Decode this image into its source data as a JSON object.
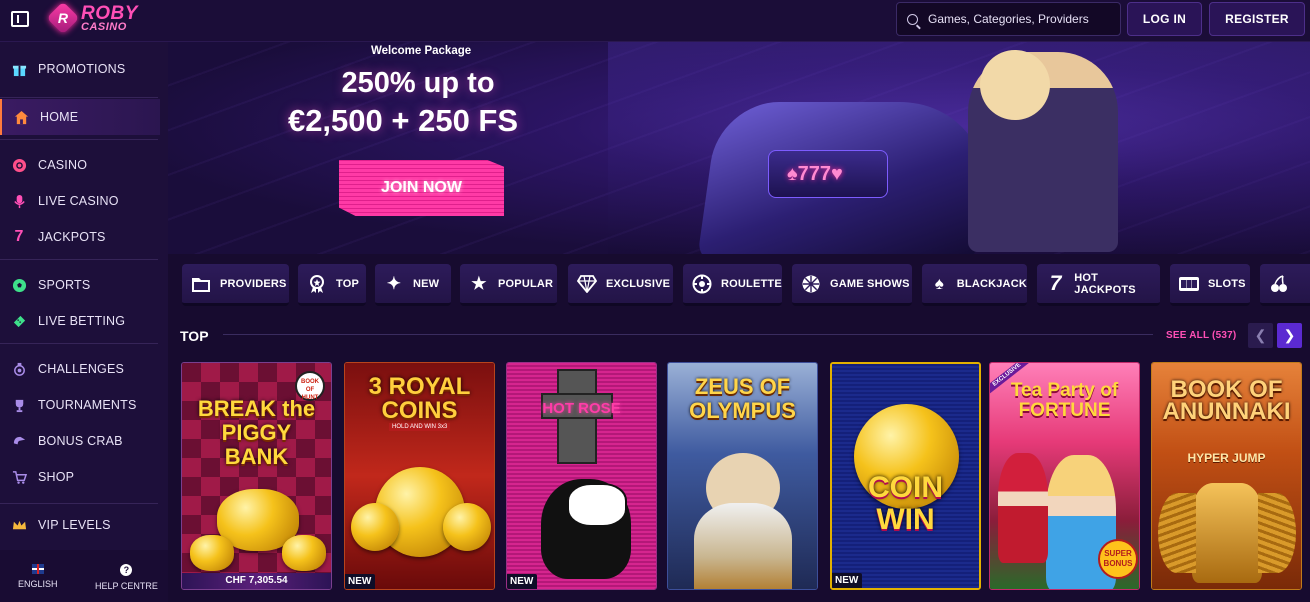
{
  "header": {
    "logo_text": "ROBY",
    "logo_sub": "CASINO",
    "search_placeholder": "Games, Categories, Providers",
    "login_label": "LOG IN",
    "register_label": "REGISTER"
  },
  "sidebar": {
    "items": [
      {
        "label": "PROMOTIONS",
        "icon": "gift-icon"
      },
      {
        "label": "HOME",
        "icon": "home-icon",
        "active": true
      },
      {
        "label": "CASINO",
        "icon": "chip-icon"
      },
      {
        "label": "LIVE CASINO",
        "icon": "microphone-icon"
      },
      {
        "label": "JACKPOTS",
        "icon": "seven-icon"
      },
      {
        "label": "SPORTS",
        "icon": "soccer-ball-icon"
      },
      {
        "label": "LIVE BETTING",
        "icon": "ticket-icon"
      },
      {
        "label": "CHALLENGES",
        "icon": "medal-icon"
      },
      {
        "label": "TOURNAMENTS",
        "icon": "trophy-icon"
      },
      {
        "label": "BONUS CRAB",
        "icon": "crab-claw-icon"
      },
      {
        "label": "SHOP",
        "icon": "cart-icon"
      },
      {
        "label": "VIP LEVELS",
        "icon": "crown-icon"
      }
    ],
    "footer": {
      "language_label": "ENGLISH",
      "help_label": "HELP CENTRE"
    }
  },
  "hero": {
    "kicker": "Welcome Package",
    "title_line1": "250% up to",
    "title_line2": "€2,500 + 250 FS",
    "cta_label": "JOIN NOW",
    "bike_text": "♠777♥"
  },
  "categories": [
    {
      "label": "PROVIDERS",
      "icon": "folder-icon"
    },
    {
      "label": "TOP",
      "icon": "award-icon"
    },
    {
      "label": "NEW",
      "icon": "sparkle-icon"
    },
    {
      "label": "POPULAR",
      "icon": "star-icon"
    },
    {
      "label": "EXCLUSIVE",
      "icon": "diamond-icon"
    },
    {
      "label": "ROULETTE",
      "icon": "roulette-icon"
    },
    {
      "label": "GAME SHOWS",
      "icon": "wheel-icon"
    },
    {
      "label": "BLACKJACK",
      "icon": "spade-icon"
    },
    {
      "label": "HOT JACKPOTS",
      "icon": "seven-icon"
    },
    {
      "label": "SLOTS",
      "icon": "slot-machine-icon"
    },
    {
      "label": "",
      "icon": "cherry-icon"
    }
  ],
  "top_section": {
    "title": "TOP",
    "see_all": "SEE ALL (537)"
  },
  "games": [
    {
      "title": "BREAK the PIGGY BANK",
      "jackpot": "CHF 7,305.54",
      "badge": "",
      "corner_logo": "BOOK OF HUNT"
    },
    {
      "title": "3 ROYAL COINS",
      "subtitle": "HOLD AND WIN 3x3",
      "badge": "NEW"
    },
    {
      "title": "HOT ROSE",
      "badge": "NEW"
    },
    {
      "title": "ZEUS OF OLYMPUS",
      "badge": ""
    },
    {
      "title": "COIN WIN",
      "badge": "NEW"
    },
    {
      "title": "Tea Party of FORTUNE",
      "ribbon": "EXCLUSIVE",
      "corner_text": "SUPER BONUS",
      "badge": ""
    },
    {
      "title": "BOOK OF ANUNNAKI",
      "subtitle": "HYPER JUMP",
      "badge": ""
    }
  ]
}
